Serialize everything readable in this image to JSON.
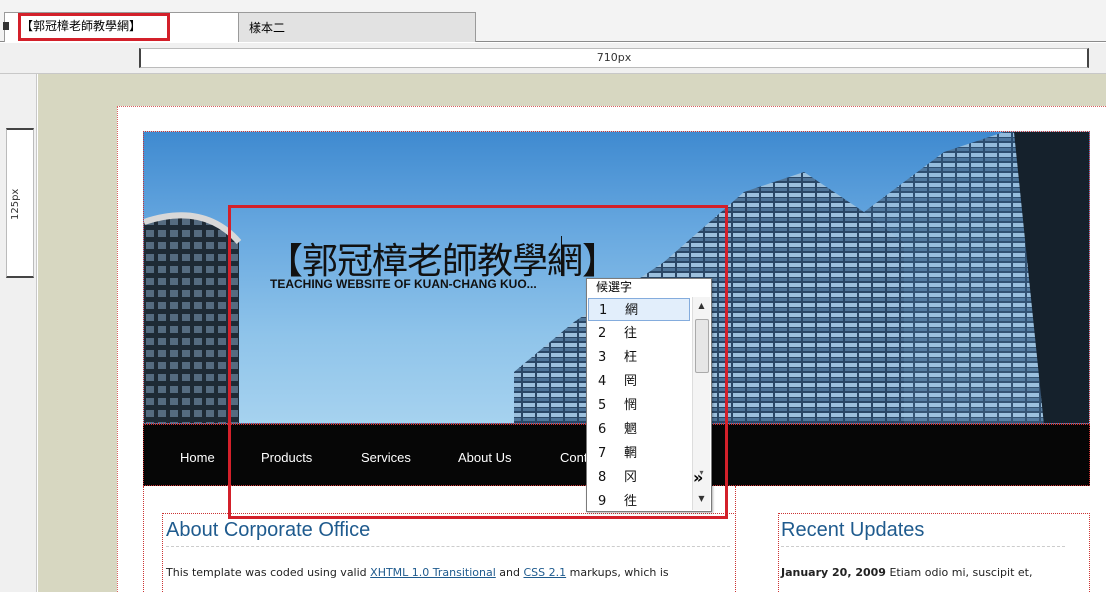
{
  "tabs": [
    {
      "label": "【郭冠樟老師教學網】"
    },
    {
      "label": "樣本二"
    }
  ],
  "ruler": {
    "width_label": "710px",
    "height_label": "125px"
  },
  "site": {
    "title": "【郭冠樟老師教學網】",
    "subtitle": "TEACHING WEBSITE OF KUAN-CHANG KUO...",
    "nav": [
      "Home",
      "Products",
      "Services",
      "About Us",
      "Cont"
    ]
  },
  "ime": {
    "header": "候選字",
    "candidates": [
      {
        "num": "1",
        "char": "網"
      },
      {
        "num": "2",
        "char": "往"
      },
      {
        "num": "3",
        "char": "枉"
      },
      {
        "num": "4",
        "char": "罔"
      },
      {
        "num": "5",
        "char": "惘"
      },
      {
        "num": "6",
        "char": "魍"
      },
      {
        "num": "7",
        "char": "輞"
      },
      {
        "num": "8",
        "char": "冈"
      },
      {
        "num": "9",
        "char": "徃"
      }
    ],
    "expand": "»"
  },
  "content": {
    "about_title": "About Corporate Office",
    "about_text_1": "This template was coded using valid ",
    "about_link_1": "XHTML 1.0 Transitional",
    "about_text_2": " and ",
    "about_link_2": "CSS 2.1",
    "about_text_3": " markups, which is",
    "recent_title": "Recent Updates",
    "recent_date": "January 20, 2009",
    "recent_text": " Etiam odio mi, suscipit et,"
  },
  "colors": {
    "highlight": "#d3202a",
    "heading": "#1f5b8e",
    "nav_bg": "#060606"
  }
}
